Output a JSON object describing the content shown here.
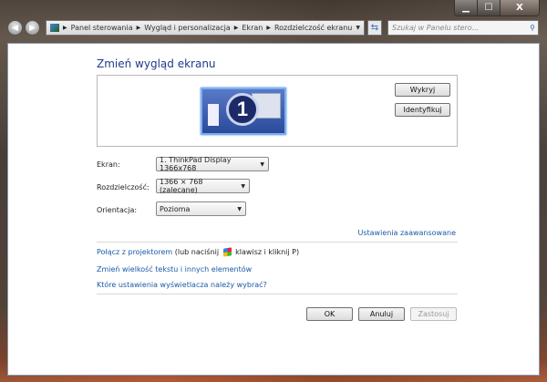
{
  "window": {
    "minimize": "▁",
    "maximize": "☐",
    "close": "X"
  },
  "nav": {
    "back": "◀",
    "forward": "▶"
  },
  "breadcrumb": [
    "Panel sterowania",
    "Wygląd i personalizacja",
    "Ekran",
    "Rozdzielczość ekranu"
  ],
  "search": {
    "placeholder": "Szukaj w Panelu stero...",
    "icon": "search-icon"
  },
  "main": {
    "title": "Zmień wygląd ekranu",
    "monitor_number": "1",
    "detect_button": "Wykryj",
    "identify_button": "Identyfikuj",
    "display_label": "Ekran:",
    "display_value": "1. ThinkPad Display 1366x768",
    "resolution_label": "Rozdzielczość:",
    "resolution_value": "1366 × 768 (zalecane)",
    "orientation_label": "Orientacja:",
    "orientation_value": "Pozioma",
    "advanced_link": "Ustawienia zaawansowane",
    "projector_link": "Połącz z projektorem",
    "projector_text_a": "(lub naciśnij",
    "projector_text_b": "klawisz i kliknij P)",
    "text_size_link": "Zmień wielkość tekstu i innych elementów",
    "which_settings_link": "Które ustawienia wyświetlacza należy wybrać?",
    "ok": "OK",
    "cancel": "Anuluj",
    "apply": "Zastosuj"
  }
}
